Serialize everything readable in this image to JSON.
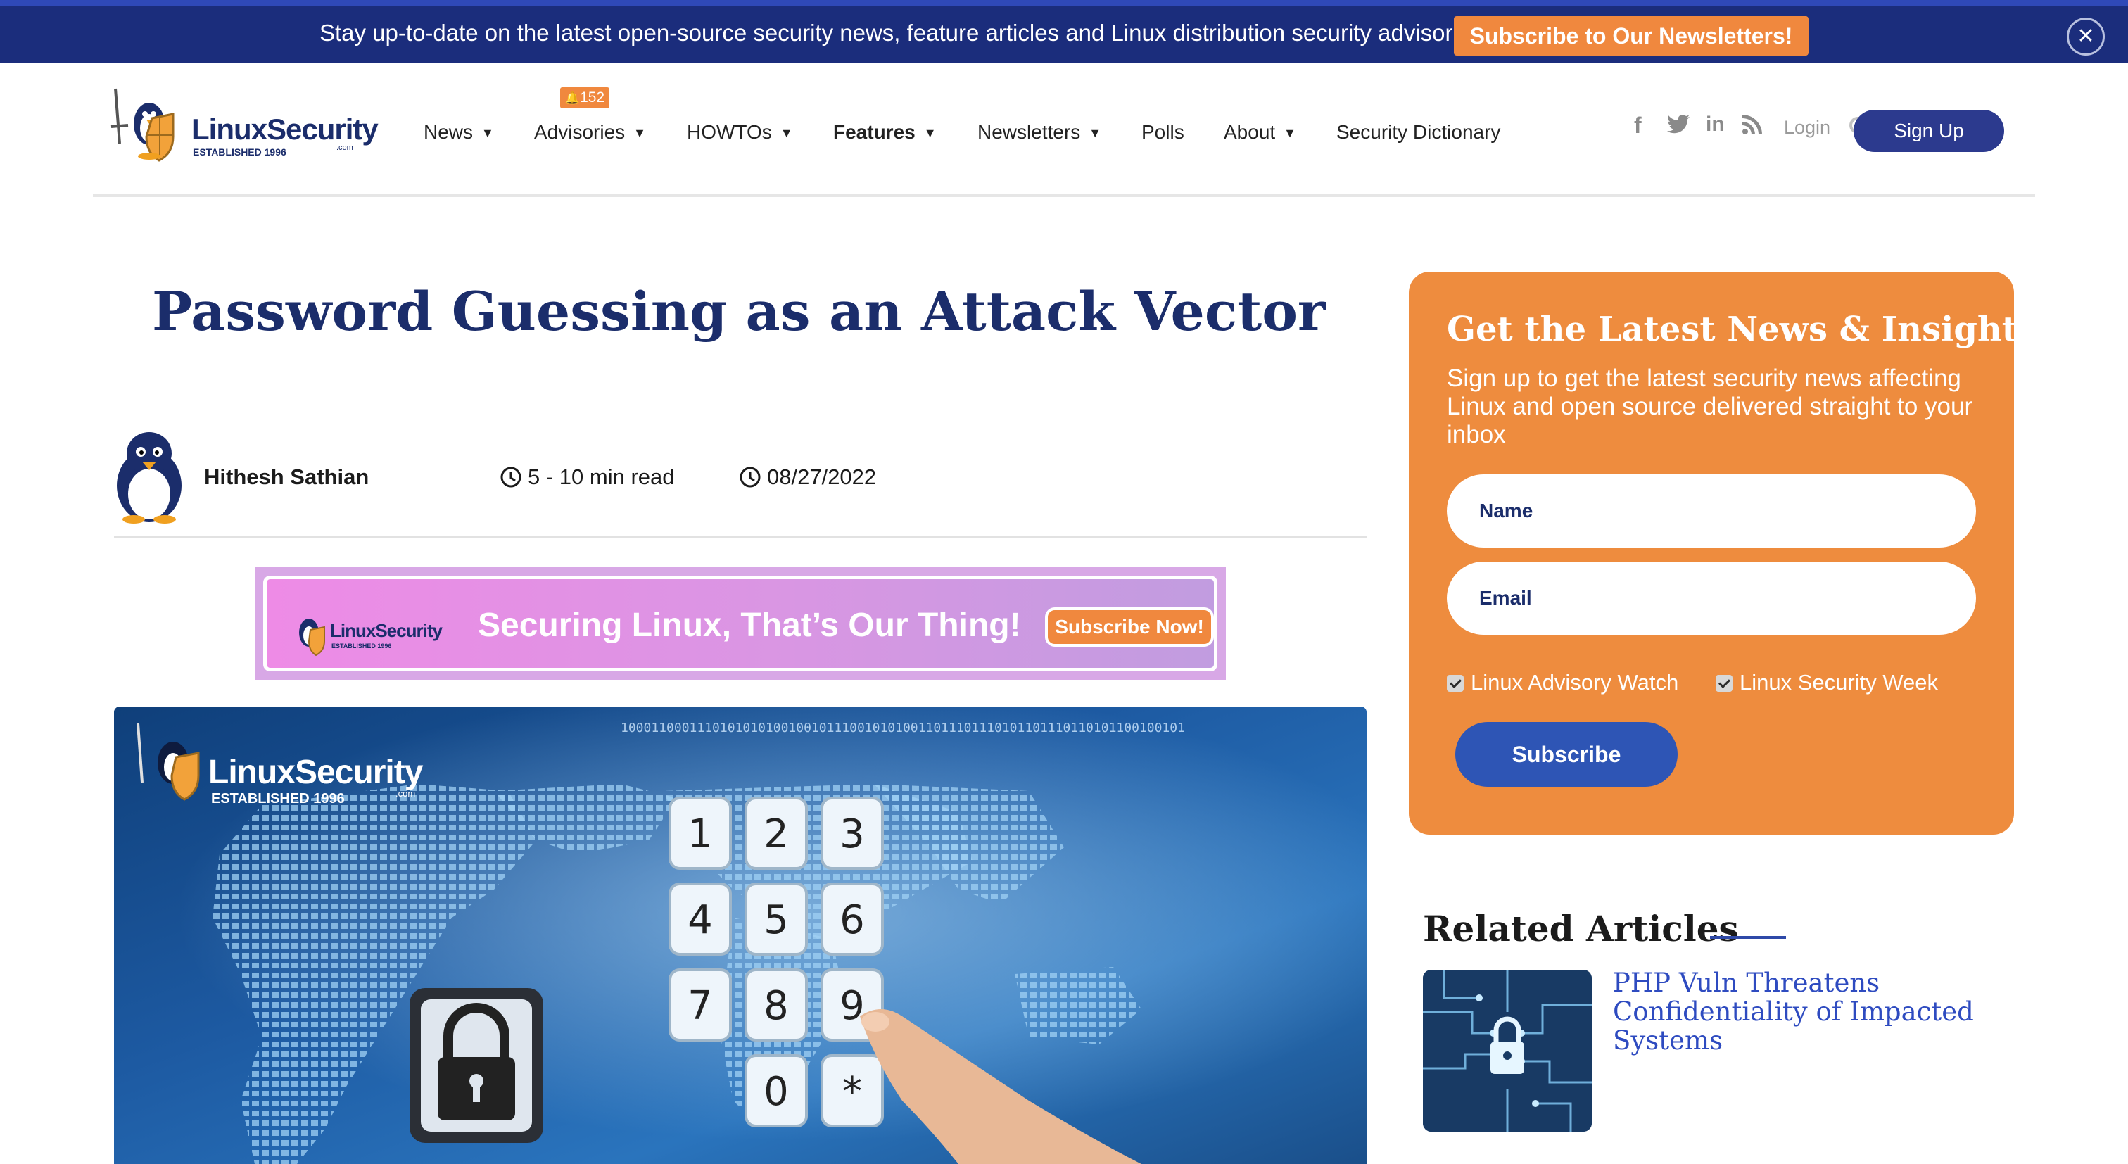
{
  "banner": {
    "text": "Stay up-to-date on the latest open-source security news, feature articles and Linux distribution security advisories",
    "cta": "Subscribe to Our Newsletters!",
    "close_icon": "close-icon",
    "close_glyph": "✕"
  },
  "brand": {
    "logo_text": "LinuxSecurity",
    "logo_tagline": "ESTABLISHED 1996",
    "logo_domain": ".com"
  },
  "nav": {
    "items": [
      {
        "label": "News",
        "dropdown": true
      },
      {
        "label": "Advisories",
        "dropdown": true,
        "badge": "152"
      },
      {
        "label": "HOWTOs",
        "dropdown": true
      },
      {
        "label": "Features",
        "dropdown": true,
        "bold": true
      },
      {
        "label": "Newsletters",
        "dropdown": true
      },
      {
        "label": "Polls",
        "dropdown": false
      },
      {
        "label": "About",
        "dropdown": true
      },
      {
        "label": "Security Dictionary",
        "dropdown": false
      }
    ],
    "chevron_glyph": "▼",
    "social": [
      {
        "icon": "facebook-icon",
        "glyph": "f"
      },
      {
        "icon": "twitter-icon",
        "glyph": "🐦"
      },
      {
        "icon": "linkedin-icon",
        "glyph": "in"
      },
      {
        "icon": "rss-icon",
        "glyph": "))"
      }
    ],
    "login": "Login",
    "signup": "Sign Up"
  },
  "article": {
    "title": "Password Guessing as an Attack Vector",
    "author": "Hithesh Sathian",
    "read_time": "5 - 10 min read",
    "date": "08/27/2022",
    "ad": {
      "logo_text": "LinuxSecurity",
      "logo_tagline": "ESTABLISHED 1996",
      "text": "Securing Linux, That’s Our Thing!",
      "cta": "Subscribe Now!"
    },
    "hero": {
      "logo_text": "LinuxSecurity",
      "logo_tagline": "ESTABLISHED 1996",
      "logo_domain": ".com",
      "keys": [
        "1",
        "2",
        "3",
        "4",
        "5",
        "6",
        "7",
        "8",
        "9",
        "0",
        "*"
      ]
    }
  },
  "newsletter": {
    "title": "Get the Latest News & Insights",
    "subtitle": "Sign up to get the latest security news affecting Linux and open source delivered straight to your inbox",
    "name_placeholder": "Name",
    "email_placeholder": "Email",
    "options": [
      {
        "label": "Linux Advisory Watch",
        "checked": true
      },
      {
        "label": "Linux Security Week",
        "checked": true
      }
    ],
    "submit": "Subscribe"
  },
  "related": {
    "heading": "Related Articles",
    "items": [
      {
        "title": "PHP Vuln Threatens Confidentiality of Impacted Systems"
      }
    ]
  },
  "colors": {
    "banner_bg": "#1b2d7c",
    "accent_orange": "#f0883e",
    "brand_navy": "#1b2d6b",
    "link_blue": "#2e4bc0",
    "button_blue": "#2e55b5"
  }
}
